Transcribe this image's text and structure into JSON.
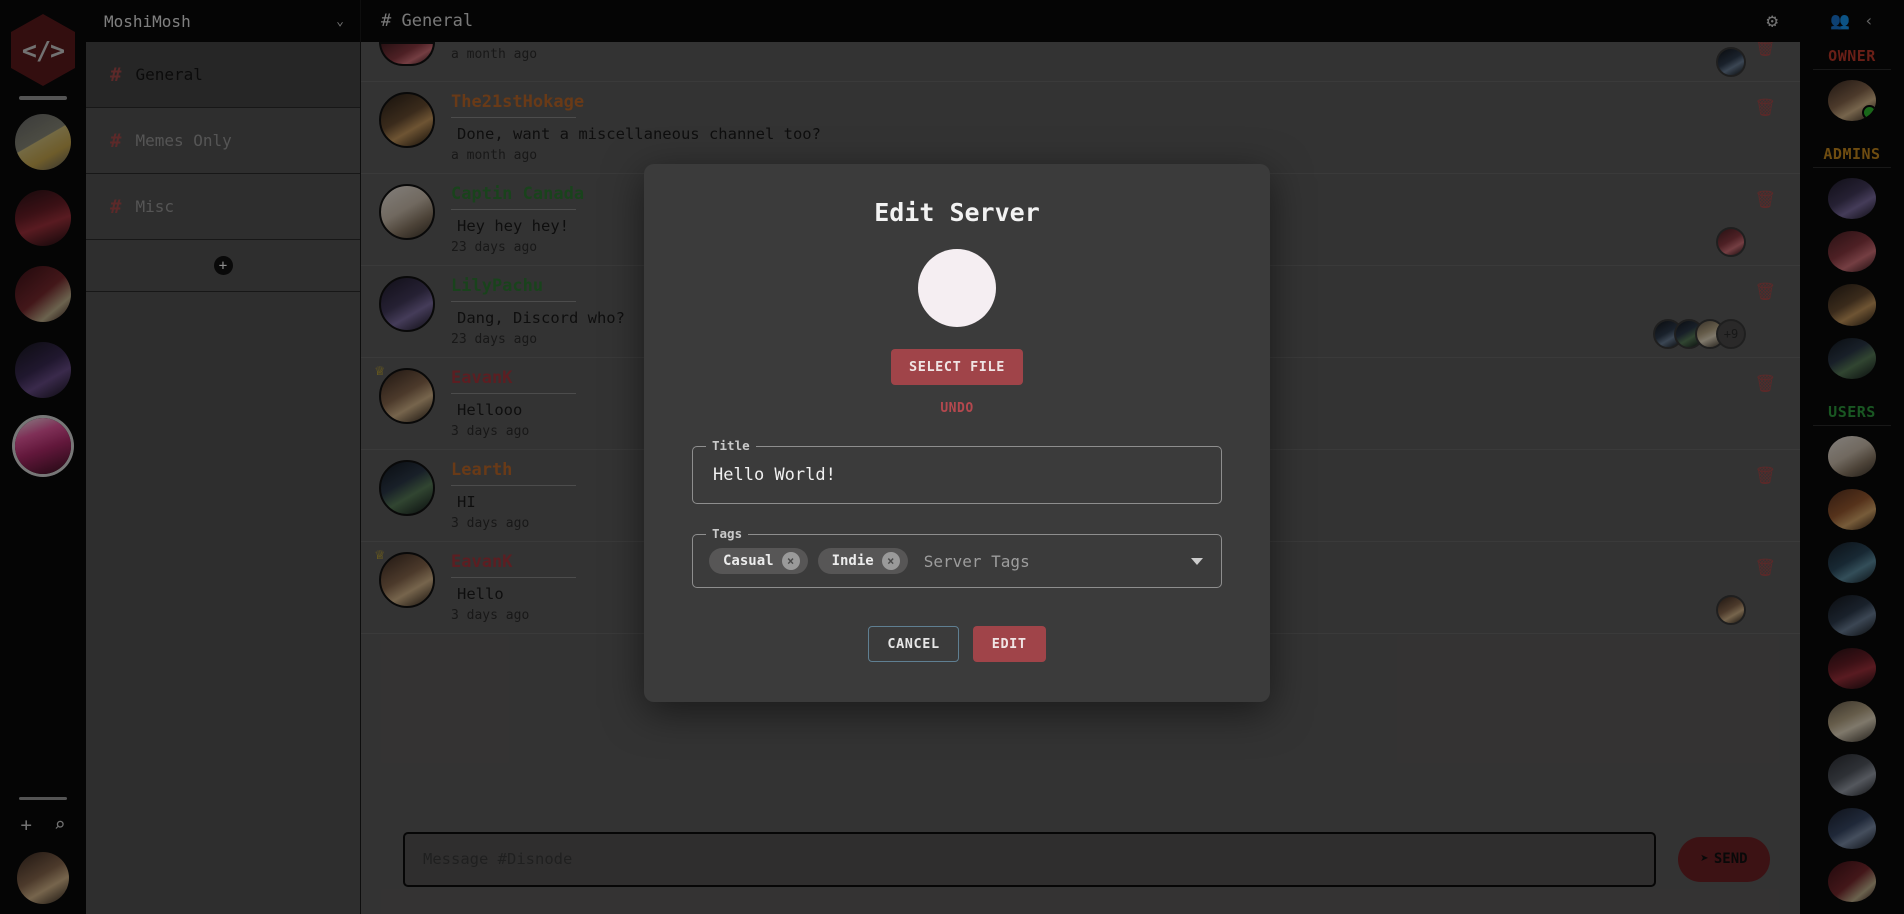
{
  "server_rail": {
    "logo_glyph": "</>",
    "servers": [
      {
        "name": "among-us-server",
        "active": false
      },
      {
        "name": "anime-server",
        "active": false
      },
      {
        "name": "ap-server",
        "active": false
      },
      {
        "name": "twitch-server",
        "active": false
      },
      {
        "name": "moshimosh-server",
        "active": true
      }
    ],
    "add_icon": "+",
    "search_icon": "⌕"
  },
  "sidebar": {
    "server_name": "MoshiMosh",
    "chevron": "⌄",
    "hash": "#",
    "channels": [
      {
        "label": "General",
        "active": true
      },
      {
        "label": "Memes Only",
        "active": false
      },
      {
        "label": "Misc",
        "active": false
      }
    ],
    "add_channel": "+"
  },
  "chat": {
    "header_title": "# General",
    "gear_icon": "⚙",
    "messages": [
      {
        "user": "",
        "color": "#c06a2a",
        "text": "",
        "time": "a month ago",
        "crown": false,
        "trash": true,
        "reactions": [],
        "partial": true
      },
      {
        "user": "The21stHokage",
        "color": "#c06a2a",
        "text": "Done, want a miscellaneous channel too?",
        "time": "a month ago",
        "crown": false,
        "trash": true,
        "reactions": []
      },
      {
        "user": "Captin Canada",
        "color": "#2f7a33",
        "text": "Hey hey hey!",
        "time": "23 days ago",
        "crown": false,
        "trash": true,
        "reactions": [
          "a12"
        ]
      },
      {
        "user": "LilyPachu",
        "color": "#2f7a33",
        "text": "Dang, Discord who?",
        "time": "23 days ago",
        "crown": false,
        "trash": true,
        "reactions": [
          "a13",
          "a9",
          "a8"
        ],
        "more": "+9"
      },
      {
        "user": "EavanK",
        "color": "#a8383e",
        "text": "Hellooo",
        "time": "3 days ago",
        "crown": true,
        "trash": true,
        "reactions": []
      },
      {
        "user": "Learth",
        "color": "#c06a2a",
        "text": "HI",
        "time": "3 days ago",
        "crown": false,
        "trash": true,
        "reactions": []
      },
      {
        "user": "EavanK",
        "color": "#a8383e",
        "text": "Hello",
        "time": "3 days ago",
        "crown": true,
        "trash": true,
        "reactions": [
          "a11"
        ]
      }
    ],
    "trash_icon": "🗑",
    "composer": {
      "placeholder": "Message #Disnode",
      "value": "",
      "send_label": "SEND",
      "send_icon": "➤"
    }
  },
  "members": {
    "people_icon": "👥",
    "collapse_icon": "‹",
    "sections": [
      {
        "title": "OWNER",
        "color": "#c0392b",
        "members": [
          {
            "avatar": "a11",
            "online": true
          }
        ]
      },
      {
        "title": "ADMINS",
        "color": "#c98a1e",
        "members": [
          {
            "avatar": "a15",
            "online": false
          },
          {
            "avatar": "a12",
            "online": false
          },
          {
            "avatar": "a10",
            "online": false
          },
          {
            "avatar": "a9",
            "online": false
          }
        ]
      },
      {
        "title": "USERS",
        "color": "#2f9e3f",
        "members": [
          {
            "avatar": "a17",
            "online": false
          },
          {
            "avatar": "a14",
            "online": false
          },
          {
            "avatar": "a16",
            "online": false
          },
          {
            "avatar": "a13",
            "online": false
          },
          {
            "avatar": "a2",
            "online": false
          },
          {
            "avatar": "a8",
            "online": false
          },
          {
            "avatar": "a18",
            "online": false
          },
          {
            "avatar": "a7",
            "online": false
          },
          {
            "avatar": "a3",
            "online": false
          }
        ]
      }
    ]
  },
  "modal": {
    "title": "Edit Server",
    "select_file_label": "SELECT FILE",
    "undo_label": "UNDO",
    "title_field": {
      "legend": "Title",
      "value": "Hello World!"
    },
    "tags_field": {
      "legend": "Tags",
      "chips": [
        {
          "label": "Casual",
          "remove_icon": "×"
        },
        {
          "label": "Indie",
          "remove_icon": "×"
        }
      ],
      "placeholder": "Server Tags"
    },
    "cancel_label": "CANCEL",
    "edit_label": "EDIT"
  },
  "colors": {
    "accent_red": "#a04449",
    "danger": "#b4484e",
    "modal_bg": "#3b3b3b",
    "chat_bg": "#5e5d5d",
    "rail_bg": "#0a0a0a"
  }
}
